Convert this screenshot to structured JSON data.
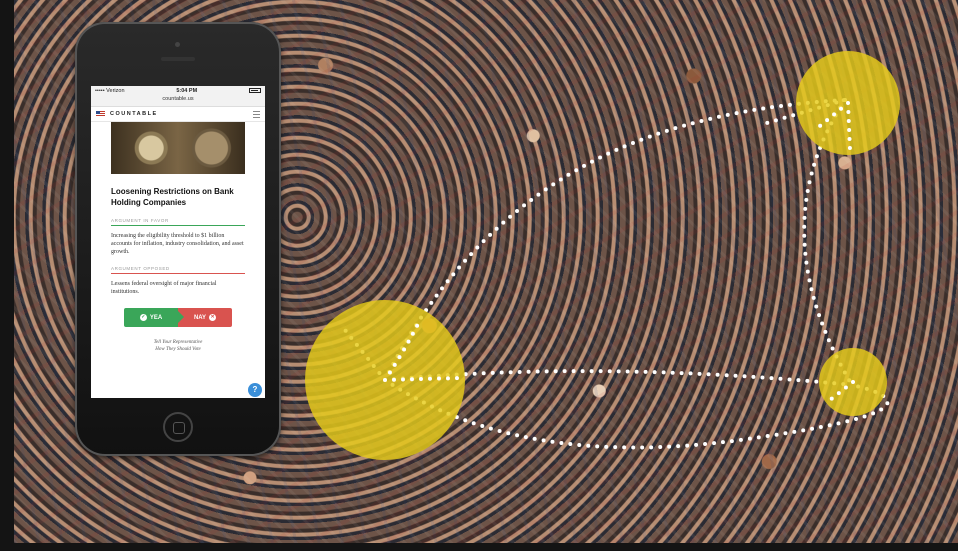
{
  "phone": {
    "status": {
      "carrier": "••••• Verizon",
      "time": "5:04 PM"
    },
    "url": "countable.us",
    "app": {
      "brand": "COUNTABLE"
    },
    "bill": {
      "title": "Loosening Restrictions on Bank Holding Companies",
      "argument_favor_label": "ARGUMENT IN FAVOR",
      "argument_favor_text": "Increasing the eligibility threshold to $1 billion accounts for inflation, industry consolidation, and asset growth.",
      "argument_opposed_label": "ARGUMENT OPPOSED",
      "argument_opposed_text": "Lessens federal oversight of major financial institutions."
    },
    "vote": {
      "yea_label": "YEA",
      "nay_label": "NAY"
    },
    "cta_line1": "Tell Your Representative",
    "cta_line2": "How They Should Vote",
    "help_label": "?"
  },
  "colors": {
    "yea": "#3aa659",
    "nay": "#d9534f",
    "highlight": "#e6cc1a",
    "help": "#3a8fd9"
  }
}
